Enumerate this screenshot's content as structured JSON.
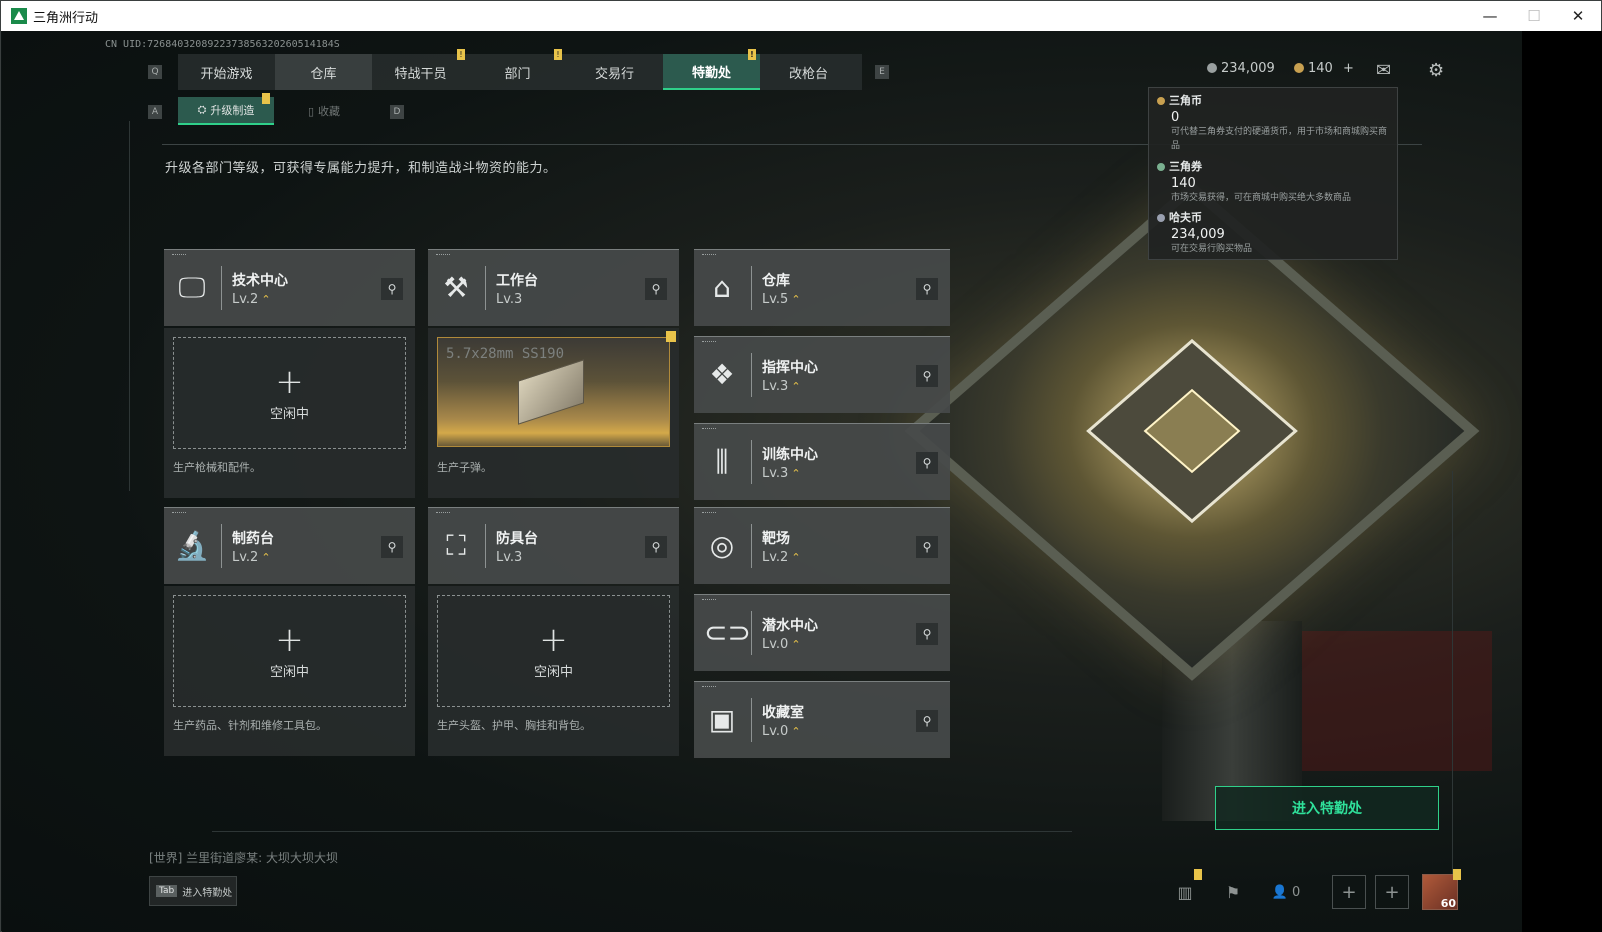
{
  "window": {
    "title": "三角洲行动",
    "controls": {
      "minimize": "—",
      "maximize": "☐",
      "close": "✕"
    }
  },
  "uid": "CN UID:7268403208922373856320260514184S",
  "nav": {
    "left_key": "Q",
    "right_key": "E",
    "tabs": [
      {
        "label": "开始游戏",
        "alert": false
      },
      {
        "label": "仓库",
        "alert": false
      },
      {
        "label": "特战干员",
        "alert": true
      },
      {
        "label": "部门",
        "alert": true
      },
      {
        "label": "交易行",
        "alert": false
      },
      {
        "label": "特勤处",
        "alert": true,
        "active": true
      },
      {
        "label": "改枪台",
        "alert": false
      }
    ]
  },
  "subnav": {
    "left_key": "A",
    "right_key": "D",
    "tabs": [
      {
        "label": "升级制造",
        "active": true,
        "alert": true
      },
      {
        "label": "收藏",
        "active": false
      }
    ]
  },
  "description": "升级各部门等级，可获得专属能力提升，和制造战斗物资的能力。",
  "currencies": {
    "havoc": "234,009",
    "coupon": "140",
    "plus": "+"
  },
  "tooltip": {
    "items": [
      {
        "name": "三角币",
        "value": "0",
        "desc": "可代替三角券支付的硬通货币，用于市场和商城购买商品"
      },
      {
        "name": "三角券",
        "value": "140",
        "desc": "市场交易获得，可在商城中购买绝大多数商品"
      },
      {
        "name": "哈夫币",
        "value": "234,009",
        "desc": "可在交易行购买物品"
      }
    ]
  },
  "departments": {
    "tech": {
      "name": "技术中心",
      "level": "Lv.2",
      "upgradable": true,
      "icon": "monitor-icon"
    },
    "workbench": {
      "name": "工作台",
      "level": "Lv.3",
      "upgradable": false,
      "icon": "tools-icon"
    },
    "storage": {
      "name": "仓库",
      "level": "Lv.5",
      "upgradable": true,
      "icon": "warehouse-icon"
    },
    "command": {
      "name": "指挥中心",
      "level": "Lv.3",
      "upgradable": true,
      "icon": "command-icon"
    },
    "training": {
      "name": "训练中心",
      "level": "Lv.3",
      "upgradable": true,
      "icon": "dumbbell-icon"
    },
    "pharmacy": {
      "name": "制药台",
      "level": "Lv.2",
      "upgradable": true,
      "icon": "microscope-icon"
    },
    "armor": {
      "name": "防具台",
      "level": "Lv.3",
      "upgradable": false,
      "icon": "cubes-icon"
    },
    "range": {
      "name": "靶场",
      "level": "Lv.2",
      "upgradable": true,
      "icon": "target-icon"
    },
    "diving": {
      "name": "潜水中心",
      "level": "Lv.0",
      "upgradable": true,
      "icon": "diving-mask-icon"
    },
    "collection": {
      "name": "收藏室",
      "level": "Lv.0",
      "upgradable": true,
      "icon": "collection-icon"
    }
  },
  "slots": {
    "tech": {
      "status": "空闲中",
      "text": "生产枪械和配件。"
    },
    "workbench": {
      "product": "5.7x28mm SS190",
      "text": "生产子弹。"
    },
    "pharmacy": {
      "status": "空闲中",
      "text": "生产药品、针剂和维修工具包。"
    },
    "armor": {
      "status": "空闲中",
      "text": "生产头盔、护甲、胸挂和背包。"
    }
  },
  "enter_button": "进入特勤处",
  "chat": "[世界] 兰里街道廖某: 大坝大坝大坝",
  "tab_hint": {
    "key": "Tab",
    "label": "进入特勤处"
  },
  "bottom": {
    "friends_count": "0",
    "level": "60"
  },
  "colors": {
    "accent": "#2fd08a",
    "alert": "#e8c34a",
    "panel": "#464a4a"
  }
}
